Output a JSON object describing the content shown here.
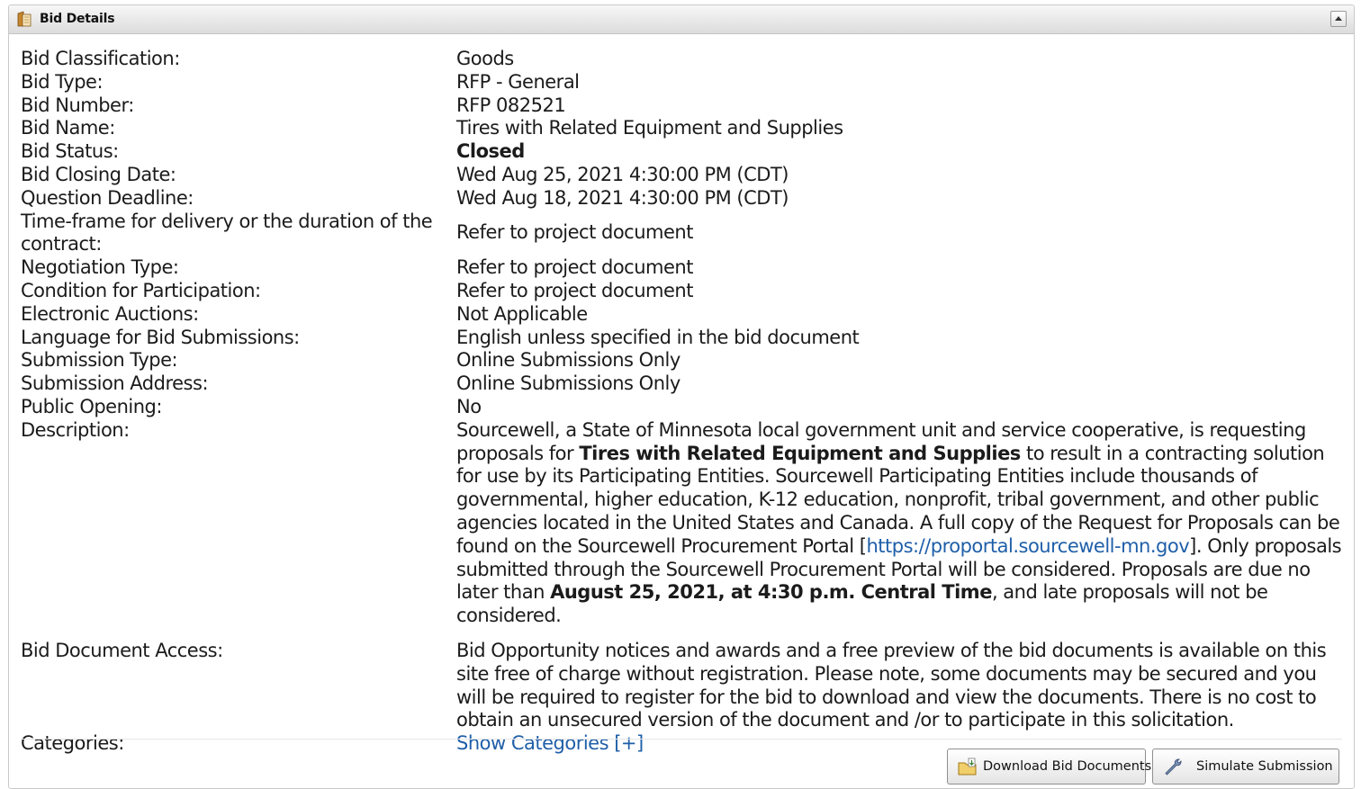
{
  "panel": {
    "title": "Bid Details"
  },
  "details": {
    "classification": {
      "label": "Bid Classification:",
      "value": "Goods"
    },
    "type": {
      "label": "Bid Type:",
      "value": "RFP - General"
    },
    "number": {
      "label": "Bid Number:",
      "value": "RFP 082521"
    },
    "name": {
      "label": "Bid Name:",
      "value": "Tires with Related Equipment and Supplies"
    },
    "status": {
      "label": "Bid Status:",
      "value": "Closed"
    },
    "closing_date": {
      "label": "Bid Closing Date:",
      "value": "Wed Aug 25, 2021 4:30:00 PM (CDT)"
    },
    "question_deadline": {
      "label": "Question Deadline:",
      "value": "Wed Aug 18, 2021 4:30:00 PM (CDT)"
    },
    "timeframe": {
      "label": "Time-frame for delivery or the duration of the contract:",
      "value": "Refer to project document"
    },
    "negotiation_type": {
      "label": "Negotiation Type:",
      "value": "Refer to project document"
    },
    "condition": {
      "label": "Condition for Participation:",
      "value": "Refer to project document"
    },
    "electronic_auctions": {
      "label": "Electronic Auctions:",
      "value": "Not Applicable"
    },
    "language": {
      "label": "Language for Bid Submissions:",
      "value": "English unless specified in the bid document"
    },
    "submission_type": {
      "label": "Submission Type:",
      "value": "Online Submissions Only"
    },
    "submission_address": {
      "label": "Submission Address:",
      "value": "Online Submissions Only"
    },
    "public_opening": {
      "label": "Public Opening:",
      "value": "No"
    },
    "description": {
      "label": "Description:",
      "text_1": "Sourcewell, a State of Minnesota local government unit and service cooperative, is requesting proposals for ",
      "bold_1": "Tires with Related Equipment and Supplies",
      "text_2": " to result in a contracting solution for use by its Participating Entities.  Sourcewell Participating Entities include thousands of governmental, higher education, K-12 education, nonprofit, tribal government, and other public agencies located in the United States and Canada. A full copy of the Request for Proposals can be found on the Sourcewell Procurement Portal [",
      "link": "https://proportal.sourcewell-mn.gov",
      "text_3": "]. Only proposals submitted through the Sourcewell Procurement Portal will be considered. Proposals are due no later than ",
      "bold_2": "August 25, 2021, at 4:30 p.m. Central Time",
      "text_4": ", and late proposals will not be considered."
    },
    "document_access": {
      "label": "Bid Document Access:",
      "value": "Bid Opportunity notices and awards and a free preview of the bid documents is available on this site free of charge without registration. Please note, some documents may be secured and you will be required to register for the bid to download and view the documents. There is no cost to obtain an unsecured version of the document and /or to participate in this solicitation."
    },
    "categories": {
      "label": "Categories:",
      "link": "Show Categories [+]"
    }
  },
  "buttons": {
    "download": "Download Bid Documents",
    "simulate": "Simulate Submission"
  },
  "icons": {
    "header": "document-folder-icon",
    "download": "folder-download-icon",
    "simulate": "wrench-icon",
    "collapse": "chevron-up-icon"
  },
  "colors": {
    "link": "#1f5fa8",
    "text": "#1b1b1b",
    "header_bg": "#dcdcdc"
  }
}
